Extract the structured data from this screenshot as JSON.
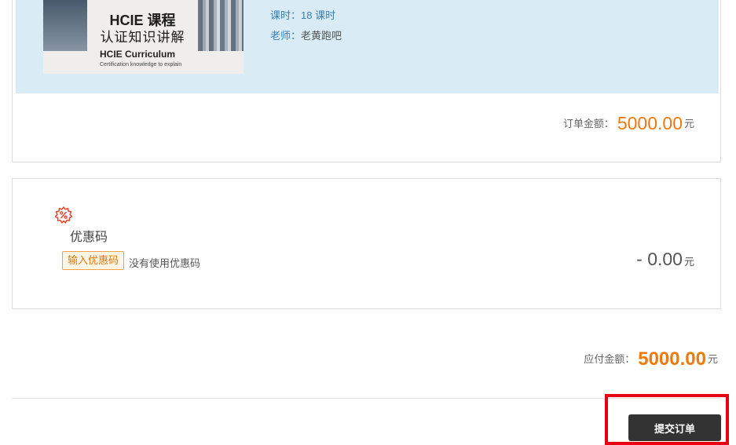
{
  "course": {
    "thumbnail": {
      "title_line1": "HCIE 课程",
      "title_line2": "认证知识讲解",
      "subtitle": "HCIE Curriculum",
      "caption": "Certification knowledge to explain"
    },
    "hours_label": "课时：",
    "hours_value": "18 课时",
    "teacher_label": "老师：",
    "teacher_value": "老黄跑吧"
  },
  "order_total": {
    "label": "订单金额：",
    "amount": "5000.00",
    "unit": "元"
  },
  "coupon": {
    "icon": "coupon-percent-icon",
    "title": "优惠码",
    "button_label": "输入优惠码",
    "status": "没有使用优惠码",
    "discount": "- 0.00",
    "unit": "元"
  },
  "payable": {
    "label": "应付金额：",
    "amount": "5000.00",
    "unit": "元"
  },
  "submit": {
    "label": "提交订单"
  },
  "colors": {
    "accent": "#ee7a0c",
    "link": "#3b7fb3",
    "highlight": "#e60012",
    "button": "#333333",
    "course_bg": "#d9ecf5"
  }
}
